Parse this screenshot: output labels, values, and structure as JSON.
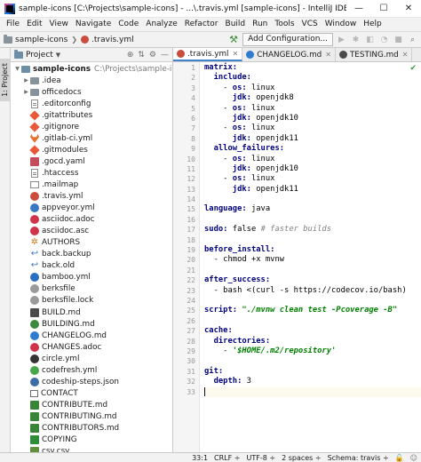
{
  "window": {
    "title": "sample-icons [C:\\Projects\\sample-icons] - ...\\.travis.yml [sample-icons] - IntelliJ IDEA",
    "minimize": "—",
    "maximize": "☐",
    "close": "✕"
  },
  "menu": [
    "File",
    "Edit",
    "View",
    "Navigate",
    "Code",
    "Analyze",
    "Refactor",
    "Build",
    "Run",
    "Tools",
    "VCS",
    "Window",
    "Help"
  ],
  "navbar": {
    "crumbs": [
      "sample-icons",
      ".travis.yml"
    ],
    "add_config_label": "Add Configuration..."
  },
  "strip": {
    "project_label": "1: Project"
  },
  "project_panel": {
    "title": "Project",
    "tree": [
      {
        "indent": 0,
        "arrow": "▼",
        "icon": "folder-open",
        "name": "sample-icons",
        "path": "C:\\Projects\\sample-icons",
        "bold": true
      },
      {
        "indent": 1,
        "arrow": "▶",
        "icon": "folder",
        "name": ".idea"
      },
      {
        "indent": 1,
        "arrow": "▶",
        "icon": "folder",
        "name": "officedocs"
      },
      {
        "indent": 1,
        "arrow": "",
        "icon": "text",
        "name": ".editorconfig"
      },
      {
        "indent": 1,
        "arrow": "",
        "icon": "git",
        "name": ".gitattributes"
      },
      {
        "indent": 1,
        "arrow": "",
        "icon": "git",
        "name": ".gitignore"
      },
      {
        "indent": 1,
        "arrow": "",
        "icon": "gitlab",
        "name": ".gitlab-ci.yml"
      },
      {
        "indent": 1,
        "arrow": "",
        "icon": "git",
        "name": ".gitmodules"
      },
      {
        "indent": 1,
        "arrow": "",
        "icon": "yaml",
        "name": ".gocd.yaml"
      },
      {
        "indent": 1,
        "arrow": "",
        "icon": "text",
        "name": ".htaccess"
      },
      {
        "indent": 1,
        "arrow": "",
        "icon": "mail",
        "name": ".mailmap"
      },
      {
        "indent": 1,
        "arrow": "",
        "icon": "travis",
        "name": ".travis.yml"
      },
      {
        "indent": 1,
        "arrow": "",
        "icon": "azure",
        "name": "appveyor.yml"
      },
      {
        "indent": 1,
        "arrow": "",
        "icon": "asciidoc",
        "name": "asciidoc.adoc"
      },
      {
        "indent": 1,
        "arrow": "",
        "icon": "asciidoc",
        "name": "asciidoc.asc"
      },
      {
        "indent": 1,
        "arrow": "",
        "icon": "authors",
        "name": "AUTHORS"
      },
      {
        "indent": 1,
        "arrow": "",
        "icon": "link",
        "name": "back.backup"
      },
      {
        "indent": 1,
        "arrow": "",
        "icon": "link",
        "name": "back.old"
      },
      {
        "indent": 1,
        "arrow": "",
        "icon": "bamboo",
        "name": "bamboo.yml"
      },
      {
        "indent": 1,
        "arrow": "",
        "icon": "berks",
        "name": "berksfile"
      },
      {
        "indent": 1,
        "arrow": "",
        "icon": "berks",
        "name": "berksfile.lock"
      },
      {
        "indent": 1,
        "arrow": "",
        "icon": "md",
        "name": "BUILD.md"
      },
      {
        "indent": 1,
        "arrow": "",
        "icon": "build",
        "name": "BUILDING.md"
      },
      {
        "indent": 1,
        "arrow": "",
        "icon": "changelog",
        "name": "CHANGELOG.md"
      },
      {
        "indent": 1,
        "arrow": "",
        "icon": "changes",
        "name": "CHANGES.adoc"
      },
      {
        "indent": 1,
        "arrow": "",
        "icon": "circleci",
        "name": "circle.yml"
      },
      {
        "indent": 1,
        "arrow": "",
        "icon": "codefresh",
        "name": "codefresh.yml"
      },
      {
        "indent": 1,
        "arrow": "",
        "icon": "codeship",
        "name": "codeship-steps.json"
      },
      {
        "indent": 1,
        "arrow": "",
        "icon": "contact",
        "name": "CONTACT"
      },
      {
        "indent": 1,
        "arrow": "",
        "icon": "contrib",
        "name": "CONTRIBUTE.md"
      },
      {
        "indent": 1,
        "arrow": "",
        "icon": "contrib",
        "name": "CONTRIBUTING.md"
      },
      {
        "indent": 1,
        "arrow": "",
        "icon": "contrib",
        "name": "CONTRIBUTORS.md"
      },
      {
        "indent": 1,
        "arrow": "",
        "icon": "copying",
        "name": "COPYING"
      },
      {
        "indent": 1,
        "arrow": "",
        "icon": "csv",
        "name": "csv.csv"
      }
    ]
  },
  "tabs": [
    {
      "label": ".travis.yml",
      "color": "#c94c3c",
      "active": true
    },
    {
      "label": "CHANGELOG.md",
      "color": "#2e7bcf",
      "active": false
    },
    {
      "label": "TESTING.md",
      "color": "#4a4a4a",
      "active": false
    }
  ],
  "code_lines": [
    [
      [
        "k",
        "matrix:"
      ]
    ],
    [
      [
        "",
        "  "
      ],
      [
        "k",
        "include:"
      ]
    ],
    [
      [
        "",
        "    - "
      ],
      [
        "k",
        "os:"
      ],
      [
        "",
        " linux"
      ]
    ],
    [
      [
        "",
        "      "
      ],
      [
        "k",
        "jdk:"
      ],
      [
        "",
        " openjdk8"
      ]
    ],
    [
      [
        "",
        "    - "
      ],
      [
        "k",
        "os:"
      ],
      [
        "",
        " linux"
      ]
    ],
    [
      [
        "",
        "      "
      ],
      [
        "k",
        "jdk:"
      ],
      [
        "",
        " openjdk10"
      ]
    ],
    [
      [
        "",
        "    - "
      ],
      [
        "k",
        "os:"
      ],
      [
        "",
        " linux"
      ]
    ],
    [
      [
        "",
        "      "
      ],
      [
        "k",
        "jdk:"
      ],
      [
        "",
        " openjdk11"
      ]
    ],
    [
      [
        "",
        "  "
      ],
      [
        "k",
        "allow_failures:"
      ]
    ],
    [
      [
        "",
        "    - "
      ],
      [
        "k",
        "os:"
      ],
      [
        "",
        " linux"
      ]
    ],
    [
      [
        "",
        "      "
      ],
      [
        "k",
        "jdk:"
      ],
      [
        "",
        " openjdk10"
      ]
    ],
    [
      [
        "",
        "    - "
      ],
      [
        "k",
        "os:"
      ],
      [
        "",
        " linux"
      ]
    ],
    [
      [
        "",
        "      "
      ],
      [
        "k",
        "jdk:"
      ],
      [
        "",
        " openjdk11"
      ]
    ],
    [],
    [
      [
        "k",
        "language:"
      ],
      [
        "",
        " java"
      ]
    ],
    [],
    [
      [
        "k",
        "sudo:"
      ],
      [
        "",
        " false "
      ],
      [
        "cm",
        "# faster builds"
      ]
    ],
    [],
    [
      [
        "k",
        "before_install:"
      ]
    ],
    [
      [
        "",
        "  - chmod +x mvnw"
      ]
    ],
    [],
    [
      [
        "k",
        "after_success:"
      ]
    ],
    [
      [
        "",
        "  - bash <(curl -s https://codecov.io/bash)"
      ]
    ],
    [],
    [
      [
        "k",
        "script:"
      ],
      [
        "",
        " "
      ],
      [
        "s",
        "\"./mvnw clean test -Pcoverage -B\""
      ]
    ],
    [],
    [
      [
        "k",
        "cache:"
      ]
    ],
    [
      [
        "",
        "  "
      ],
      [
        "k",
        "directories:"
      ]
    ],
    [
      [
        "",
        "    - "
      ],
      [
        "s",
        "'$HOME/.m2/repository'"
      ]
    ],
    [],
    [
      [
        "k",
        "git:"
      ]
    ],
    [
      [
        "",
        "  "
      ],
      [
        "k",
        "depth:"
      ],
      [
        "",
        " 3"
      ]
    ],
    []
  ],
  "status": {
    "position": "33:1",
    "line_sep": "CRLF ÷",
    "encoding": "UTF-8 ÷",
    "indent": "2 spaces ÷",
    "schema": "Schema: travis ÷"
  }
}
